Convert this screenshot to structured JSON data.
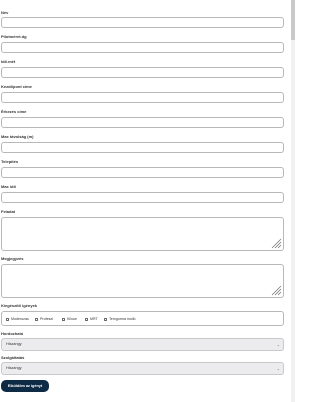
{
  "form": {
    "fields": [
      {
        "label": "Név"
      },
      {
        "label": "Pilotméret.dg"
      },
      {
        "label": "Idő.mét"
      },
      {
        "label": "Kezdőpont címe"
      },
      {
        "label": "Érkezés címe"
      },
      {
        "label": "Max távolság (m)"
      },
      {
        "label": "Telepítés"
      },
      {
        "label": "Max idő"
      }
    ],
    "textareas": [
      {
        "label": "Feladat"
      },
      {
        "label": "Megjegyzés"
      }
    ],
    "checkbox_group": {
      "label": "Kiegészítő igények",
      "options": [
        "Moderozas",
        "Profeszi",
        "Kiloue",
        "MRT",
        "Tervgorma mulló"
      ]
    },
    "selects": [
      {
        "label": "Hordozható",
        "value": "Hiszángy"
      },
      {
        "label": "Szolgáltatás",
        "value": "Hiszángy"
      }
    ],
    "submit_label": "Elküldöm az igényt"
  }
}
